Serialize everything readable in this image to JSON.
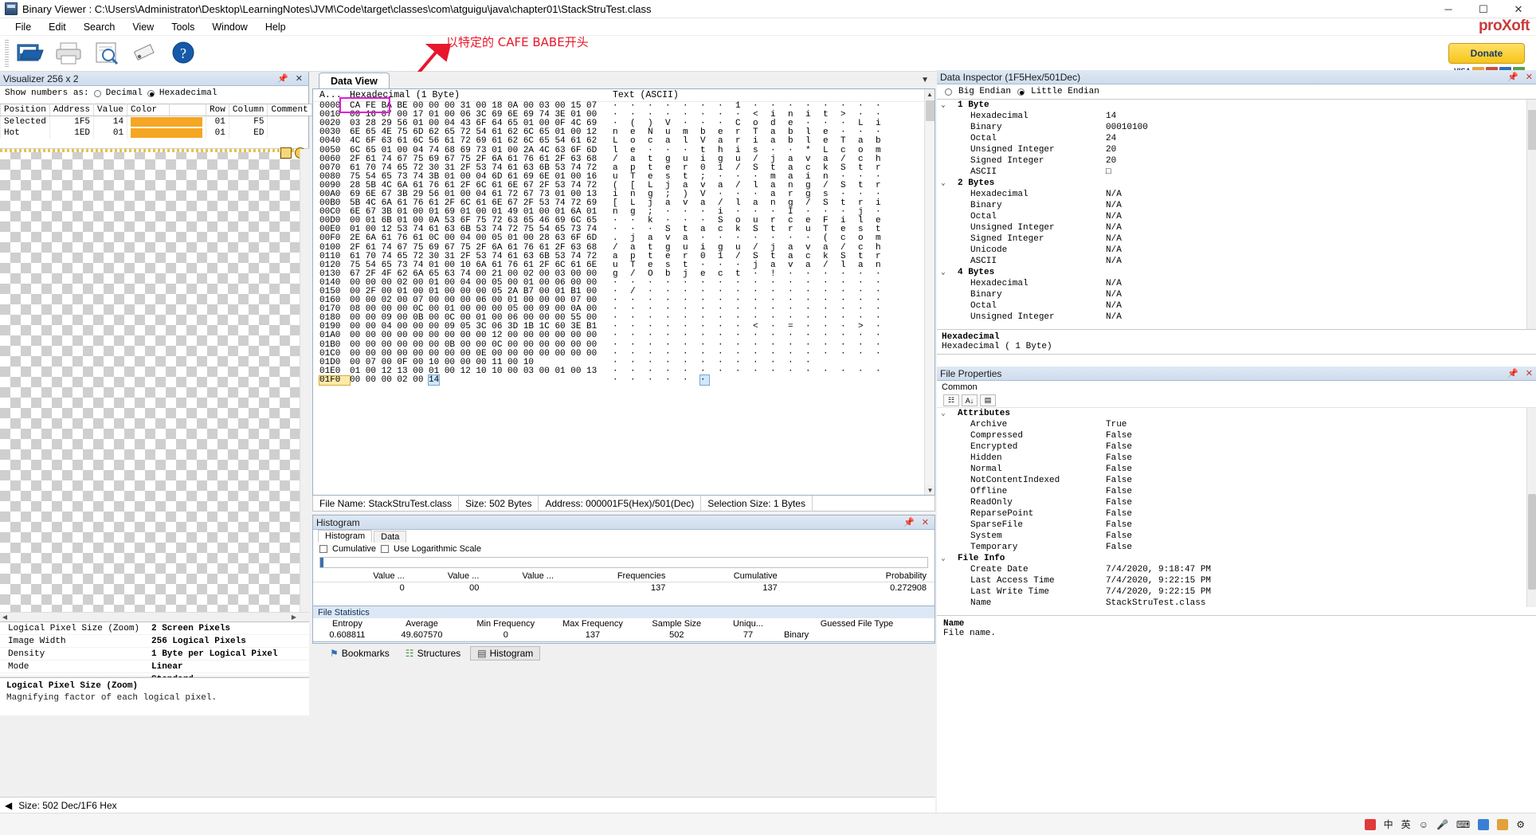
{
  "window": {
    "title": "Binary Viewer : C:\\Users\\Administrator\\Desktop\\LearningNotes\\JVM\\Code\\target\\classes\\com\\atguigu\\java\\chapter01\\StackStruTest.class",
    "minimize": "─",
    "maximize": "☐",
    "close": "✕"
  },
  "menu": {
    "items": [
      "File",
      "Edit",
      "Search",
      "View",
      "Tools",
      "Window",
      "Help"
    ]
  },
  "brand": {
    "name_a": "pro",
    "name_b": "X",
    "name_c": "oft",
    "donate": "Donate",
    "visa": "VISA"
  },
  "annotation": {
    "text": "以特定的 CAFE BABE开头",
    "color": "#e8172b"
  },
  "visualizer": {
    "title": "Visualizer 256 x 2",
    "show_numbers_label": "Show numbers as:",
    "option_decimal": "Decimal",
    "option_hex": "Hexadecimal",
    "selected_option": "Hexadecimal",
    "columns": [
      "Position",
      "Address",
      "Value",
      "Color",
      "",
      "Row",
      "Column",
      "Comment"
    ],
    "rows": [
      {
        "position": "Selected",
        "address": "1F5",
        "value": "14",
        "color": "#f5a623",
        "row": "01",
        "column": "F5",
        "comment": ""
      },
      {
        "position": "Hot",
        "address": "1ED",
        "value": "01",
        "color": "#f5a623",
        "row": "01",
        "column": "ED",
        "comment": ""
      }
    ],
    "props": [
      {
        "key": "Logical Pixel Size (Zoom)",
        "value": "2 Screen Pixels"
      },
      {
        "key": "Image Width",
        "value": "256 Logical Pixels"
      },
      {
        "key": "Density",
        "value": "1 Byte per Logical Pixel"
      },
      {
        "key": "Mode",
        "value": "Linear"
      },
      {
        "key": "",
        "value": "Standard"
      }
    ],
    "help_title": "Logical Pixel Size (Zoom)",
    "help_text": "Magnifying factor of each logical pixel."
  },
  "dataview": {
    "tab": "Data View",
    "col_address": "A...",
    "col_hex": "Hexadecimal  (1 Byte)",
    "col_text": "Text (ASCII)",
    "rows": [
      {
        "addr": "0000",
        "hex": "CA FE BA BE 00 00 00 31 00 18 0A 00 03 00 15 07",
        "ascii": "· · · · · · · 1 · · · · · · · ·"
      },
      {
        "addr": "0010",
        "hex": "00 16 07 00 17 01 00 06 3C 69 6E 69 74 3E 01 00",
        "ascii": "· · · · · · · · < i n i t > · ·"
      },
      {
        "addr": "0020",
        "hex": "03 28 29 56 01 00 04 43 6F 64 65 01 00 0F 4C 69",
        "ascii": "· ( ) V · · · C o d e · · · L i"
      },
      {
        "addr": "0030",
        "hex": "6E 65 4E 75 6D 62 65 72 54 61 62 6C 65 01 00 12",
        "ascii": "n e N u m b e r T a b l e · · ·"
      },
      {
        "addr": "0040",
        "hex": "4C 6F 63 61 6C 56 61 72 69 61 62 6C 65 54 61 62",
        "ascii": "L o c a l V a r i a b l e T a b"
      },
      {
        "addr": "0050",
        "hex": "6C 65 01 00 04 74 68 69 73 01 00 2A 4C 63 6F 6D",
        "ascii": "l e · · · t h i s · · * L c o m"
      },
      {
        "addr": "0060",
        "hex": "2F 61 74 67 75 69 67 75 2F 6A 61 76 61 2F 63 68",
        "ascii": "/ a t g u i g u / j a v a / c h"
      },
      {
        "addr": "0070",
        "hex": "61 70 74 65 72 30 31 2F 53 74 61 63 6B 53 74 72",
        "ascii": "a p t e r 0 1 / S t a c k S t r"
      },
      {
        "addr": "0080",
        "hex": "75 54 65 73 74 3B 01 00 04 6D 61 69 6E 01 00 16",
        "ascii": "u T e s t ; · · · m a i n · · ·"
      },
      {
        "addr": "0090",
        "hex": "28 5B 4C 6A 61 76 61 2F 6C 61 6E 67 2F 53 74 72",
        "ascii": "( [ L j a v a / l a n g / S t r"
      },
      {
        "addr": "00A0",
        "hex": "69 6E 67 3B 29 56 01 00 04 61 72 67 73 01 00 13",
        "ascii": "i n g ; ) V · · · a r g s · · ·"
      },
      {
        "addr": "00B0",
        "hex": "5B 4C 6A 61 76 61 2F 6C 61 6E 67 2F 53 74 72 69",
        "ascii": "[ L j a v a / l a n g / S t r i"
      },
      {
        "addr": "00C0",
        "hex": "6E 67 3B 01 00 01 69 01 00 01 49 01 00 01 6A 01",
        "ascii": "n g ; · · · i · · · I · · · j ·"
      },
      {
        "addr": "00D0",
        "hex": "00 01 6B 01 00 0A 53 6F 75 72 63 65 46 69 6C 65",
        "ascii": "· · k · · · S o u r c e F i l e"
      },
      {
        "addr": "00E0",
        "hex": "01 00 12 53 74 61 63 6B 53 74 72 75 54 65 73 74",
        "ascii": "· · · S t a c k S t r u T e s t"
      },
      {
        "addr": "00F0",
        "hex": "2E 6A 61 76 61 0C 00 04 00 05 01 00 28 63 6F 6D",
        "ascii": ". j a v a · · · · · · · ( c o m"
      },
      {
        "addr": "0100",
        "hex": "2F 61 74 67 75 69 67 75 2F 6A 61 76 61 2F 63 68",
        "ascii": "/ a t g u i g u / j a v a / c h"
      },
      {
        "addr": "0110",
        "hex": "61 70 74 65 72 30 31 2F 53 74 61 63 6B 53 74 72",
        "ascii": "a p t e r 0 1 / S t a c k S t r"
      },
      {
        "addr": "0120",
        "hex": "75 54 65 73 74 01 00 10 6A 61 76 61 2F 6C 61 6E",
        "ascii": "u T e s t · · · j a v a / l a n"
      },
      {
        "addr": "0130",
        "hex": "67 2F 4F 62 6A 65 63 74 00 21 00 02 00 03 00 00",
        "ascii": "g / O b j e c t · ! · · · · · ·"
      },
      {
        "addr": "0140",
        "hex": "00 00 00 02 00 01 00 04 00 05 00 01 00 06 00 00",
        "ascii": "· · · · · · · · · · · · · · · ·"
      },
      {
        "addr": "0150",
        "hex": "00 2F 00 01 00 01 00 00 00 05 2A B7 00 01 B1 00",
        "ascii": "· / · · · · · · · · · · · · · ·"
      },
      {
        "addr": "0160",
        "hex": "00 00 02 00 07 00 00 00 06 00 01 00 00 00 07 00",
        "ascii": "· · · · · · · · · · · · · · · ·"
      },
      {
        "addr": "0170",
        "hex": "08 00 00 00 0C 00 01 00 00 00 05 00 09 00 0A 00",
        "ascii": "· · · · · · · · · · · · · · · ·"
      },
      {
        "addr": "0180",
        "hex": "00 00 09 00 0B 00 0C 00 01 00 06 00 00 00 55 00",
        "ascii": "· · · · · · · · · · · · · · · ·"
      },
      {
        "addr": "0190",
        "hex": "00 00 04 00 00 00 09 05 3C 06 3D 1B 1C 60 3E B1",
        "ascii": "· · · · · · · · < · = · · · > ·"
      },
      {
        "addr": "01A0",
        "hex": "00 00 00 00 00 00 00 00 00 12 00 00 00 00 00 00",
        "ascii": "· · · · · · · · · · · · · · · ·"
      },
      {
        "addr": "01B0",
        "hex": "00 00 00 00 00 00 0B 00 00 0C 00 00 00 00 00 00",
        "ascii": "· · · · · · · · · · · · · · · ·"
      },
      {
        "addr": "01C0",
        "hex": "00 00 00 00 00 00 00 00 0E 00 00 00 00 00 00 00",
        "ascii": "· · · · · · · · · · · · · · · ·"
      },
      {
        "addr": "01D0",
        "hex": "00 07 00 0F 00 10 00 00 00 11 00 10",
        "ascii": "· · · · · · · · · · · ·"
      },
      {
        "addr": "01E0",
        "hex": "01 00 12 13 00 01 00 12 10 10 00 03 00 01 00 13",
        "ascii": "· · · · · · · · · · · · · · · ·"
      },
      {
        "addr": "01F0",
        "hex": "00 00 00 02 00 14",
        "ascii": "· · · · · ·"
      }
    ],
    "status": {
      "file_name": "File Name: StackStruTest.class",
      "size": "Size: 502 Bytes",
      "address": "Address: 000001F5(Hex)/501(Dec)",
      "selection": "Selection Size: 1 Bytes"
    }
  },
  "histogram": {
    "title": "Histogram",
    "tabs": [
      "Histogram",
      "Data"
    ],
    "active_tab": "Histogram",
    "cumulative_label": "Cumulative",
    "log_label": "Use Logarithmic Scale",
    "columns": [
      "Value ...",
      "Value ...",
      "Value ...",
      "Frequencies",
      "Cumulative",
      "Probability"
    ],
    "row": [
      "0",
      "00",
      "",
      "137",
      "137",
      "0.272908"
    ]
  },
  "file_statistics": {
    "title": "File Statistics",
    "columns": [
      "Entropy",
      "Average",
      "Min  Frequency",
      "Max   Frequency",
      "Sample Size",
      "Uniqu...",
      "Guessed File Type"
    ],
    "values": [
      "0.608811",
      "49.607570",
      "0",
      "137",
      "502",
      "77",
      "Binary"
    ]
  },
  "bottom_tabs": [
    {
      "label": "Bookmarks",
      "icon": "bookmark-icon",
      "active": false
    },
    {
      "label": "Structures",
      "icon": "structure-icon",
      "active": false
    },
    {
      "label": "Histogram",
      "icon": "histogram-icon",
      "active": true
    }
  ],
  "status_bar": {
    "text": "Size: 502 Dec/1F6 Hex"
  },
  "data_inspector": {
    "title": "Data Inspector (1F5Hex/501Dec)",
    "big_endian": "Big Endian",
    "little_endian": "Little Endian",
    "selected_endian": "Little Endian",
    "groups": [
      {
        "name": "1 Byte",
        "rows": [
          {
            "name": "Hexadecimal",
            "value": "14"
          },
          {
            "name": "Binary",
            "value": "00010100"
          },
          {
            "name": "Octal",
            "value": "24"
          },
          {
            "name": "Unsigned Integer",
            "value": "20"
          },
          {
            "name": "Signed Integer",
            "value": "20"
          },
          {
            "name": "ASCII",
            "value": "□"
          }
        ]
      },
      {
        "name": "2 Bytes",
        "rows": [
          {
            "name": "Hexadecimal",
            "value": "N/A"
          },
          {
            "name": "Binary",
            "value": "N/A"
          },
          {
            "name": "Octal",
            "value": "N/A"
          },
          {
            "name": "Unsigned Integer",
            "value": "N/A"
          },
          {
            "name": "Signed Integer",
            "value": "N/A"
          },
          {
            "name": "Unicode",
            "value": "N/A"
          },
          {
            "name": "ASCII",
            "value": "N/A"
          }
        ]
      },
      {
        "name": "4 Bytes",
        "rows": [
          {
            "name": "Hexadecimal",
            "value": "N/A"
          },
          {
            "name": "Binary",
            "value": "N/A"
          },
          {
            "name": "Octal",
            "value": "N/A"
          },
          {
            "name": "Unsigned Integer",
            "value": "N/A"
          }
        ]
      }
    ],
    "footer_title": "Hexadecimal",
    "footer_text": "Hexadecimal ( 1 Byte)"
  },
  "file_properties": {
    "title": "File Properties",
    "section": "Common",
    "groups": [
      {
        "name": "Attributes",
        "rows": [
          {
            "name": "Archive",
            "value": "True"
          },
          {
            "name": "Compressed",
            "value": "False"
          },
          {
            "name": "Encrypted",
            "value": "False"
          },
          {
            "name": "Hidden",
            "value": "False"
          },
          {
            "name": "Normal",
            "value": "False"
          },
          {
            "name": "NotContentIndexed",
            "value": "False"
          },
          {
            "name": "Offline",
            "value": "False"
          },
          {
            "name": "ReadOnly",
            "value": "False"
          },
          {
            "name": "ReparsePoint",
            "value": "False"
          },
          {
            "name": "SparseFile",
            "value": "False"
          },
          {
            "name": "System",
            "value": "False"
          },
          {
            "name": "Temporary",
            "value": "False"
          }
        ]
      },
      {
        "name": "File Info",
        "rows": [
          {
            "name": "Create Date",
            "value": "7/4/2020, 9:18:47 PM"
          },
          {
            "name": "Last Access Time",
            "value": "7/4/2020, 9:22:15 PM"
          },
          {
            "name": "Last Write Time",
            "value": "7/4/2020, 9:22:15 PM"
          },
          {
            "name": "Name",
            "value": "StackStruTest.class"
          }
        ]
      }
    ],
    "footer_title": "Name",
    "footer_text": "File name."
  },
  "taskbar": {
    "ime": "中",
    "lang": "英"
  }
}
